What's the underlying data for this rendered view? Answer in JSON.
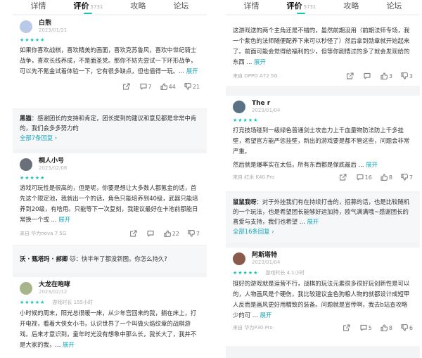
{
  "tabs": [
    {
      "label": "详情"
    },
    {
      "label": "评价",
      "count": "5731"
    },
    {
      "label": "攻略"
    },
    {
      "label": "论坛"
    }
  ],
  "left_reviews": [
    {
      "user": "白熊",
      "date": "2023/01/21",
      "stars": "★★★★★",
      "text": "如果你喜欢战棋，喜欢精美的画面，喜欢克苏鲁风，喜欢中世纪骑士战争，喜欢长线养成，不是面圣党。那你不妨先尝试一下环形战争，可以先不氪金试着体验一下，它有很多缺点，但也值得一玩。...",
      "more": "展开",
      "comments": "7",
      "likes": "44",
      "dislikes": "21"
    },
    {
      "user": "桐人小号",
      "date": "2023/02/06",
      "stars": "★★★★★",
      "text": "游戏可玩性是很高的，但是呢，你要是想让大多数人都氪金的话，首先这个限定池，我就出一个的话，角色只能培养到40级，武器只能培养到20级，有啥用。只能等下一次复刻，我建议最好在卡池前都能日常换一个或 ...",
      "more": "展开",
      "device": "来自 华为nova 7 5G",
      "comments": "",
      "likes": "22",
      "dislikes": "7"
    },
    {
      "user": "大龙在咆哮",
      "date": "2023/02/12",
      "stars": "★★★★★",
      "playtime": "游戏时长 155小时",
      "text": "小时候的周末，阳光总很暖一床，从少年宫回来的我，躺在床上，打开电视，看着大侠女小书，认识世界了一个叫做火焰纹章的战棋游戏。后来才意识到，童年时光没有想象中那么长，我长大了，我并不是大家的我，... ",
      "more": "展开"
    }
  ],
  "left_replies": [
    {
      "author": "黑猫",
      "text": "：感谢团长的支持和肯定，团长提到的建议和意见都是非常中肯的，我们会多多努力的",
      "link": "全部7条回复 ›"
    },
    {
      "author": "沃 · 甄塔玛 · 郝卿",
      "text": "：快半年了都没新图。你怎么持久?",
      "link": ""
    }
  ],
  "right_reviews": [
    {
      "text": "这游戏送的两个主角还是不错的，虽然前期没用（前期法师专场，我一个紫色的法师随便配养下来可以秒怪了）然后拿到勋章就开始起来了。前面可能会觉得给福利的少，但等你剧情过的多了就会发现给的东西 ...",
      "more": "展开",
      "device": "来自 OPPO A72 5G",
      "comments": "",
      "likes": "3",
      "dislikes": "3"
    },
    {
      "user": "The r",
      "date": "2023/01/04",
      "stars": "★★★★★",
      "text": "打竞技场碰到一级绿色普通剑士攻击力上千血量物防法防上千多挂壁，希望官方能严惩挂壁，新出的游戏要是都不管这些，问题会非常严重。",
      "text2": "然后就是爆率实在太低，所有东西都是保底最后 ...",
      "more": "展开",
      "device": "来自 红米 K40 Pro",
      "comments": "16",
      "likes": "8",
      "dislikes": "7"
    },
    {
      "user": "阿斯塔特",
      "date": "2023/01/04",
      "stars": "★★★★★",
      "playtime": "游戏时长 4.1小时",
      "text": "挺好的游戏就是运营不行，战棋的玩法元素很多很好玩创新性是可以的，人物画风是个硬伤，我比较建议金色狗粮人物的就都设计成短甲人反而是画风更好用精致的装备。问题就是宣传啊，我去b站查攻略少的可 ...",
      "more": "展开",
      "device": "来自 华为P30 Pro",
      "comments": "5",
      "likes": "8",
      "dislikes": "6"
    }
  ],
  "right_reply": {
    "author": "鼠鼠我呀",
    "text": "：对于外挂我们有在持续打击的，招募的话，也是比较随机的一个玩法，也是希望团长能够好运加持，欧气满满哦~感谢团长的喜爱与支持，我们也希望 ...",
    "more": "展开",
    "link": "全部16条回复 ›"
  },
  "colors": {
    "accent": "#14c5b8",
    "link": "#14a6b8"
  },
  "icons": [
    "share-icon",
    "comment-icon",
    "thumb-up-icon",
    "thumb-down-icon",
    "dropdown-icon",
    "cat-icon"
  ]
}
